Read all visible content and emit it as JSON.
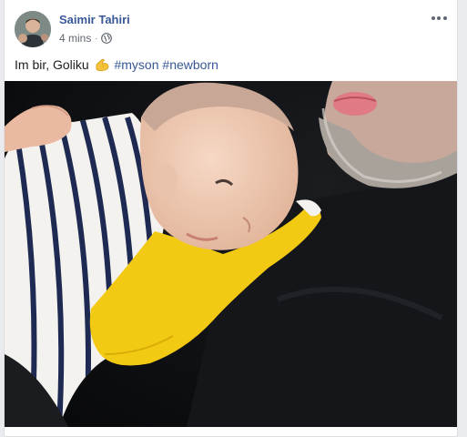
{
  "post": {
    "author": "Saimir Tahiri",
    "time": "4 mins",
    "separator": "·",
    "privacy_icon": "globe-icon",
    "more_icon": "more-options-icon",
    "text_prefix": "Im bir, Goliku",
    "emoji_icon": "flexed-biceps-icon",
    "hashtags": [
      "#myson",
      "#newborn"
    ],
    "photo": {
      "icon": "photo-newborn-with-father",
      "colors": {
        "background": "#101214",
        "shirt_white": "#f4f2ee",
        "stripes": "#1e2a52",
        "yellow": "#f2c913",
        "skin": "#f1cfba",
        "beard": "#b9b3ab"
      }
    }
  },
  "colors": {
    "link": "#385898",
    "text": "#1c1e21",
    "meta": "#616770"
  }
}
